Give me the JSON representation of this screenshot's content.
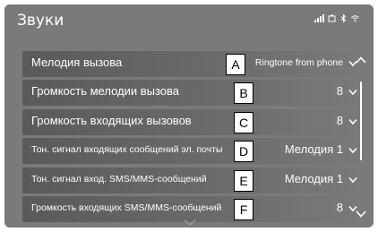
{
  "header": {
    "title": "Звуки"
  },
  "status_icons": [
    "signal-bars-icon",
    "battery-icon",
    "bluetooth-icon",
    "wifi-icon"
  ],
  "rows": [
    {
      "label": "Мелодия вызова",
      "tag": "A",
      "value": "Ringtone from phone"
    },
    {
      "label": "Громкость мелодии вызова",
      "tag": "B",
      "value": "8"
    },
    {
      "label": "Громкость входящих вызовов",
      "tag": "C",
      "value": "8"
    },
    {
      "label": "Тон. сигнал входящих сообщений эл. почты",
      "tag": "D",
      "value": "Мелодия 1"
    },
    {
      "label": "Тон. сигнал вход. SMS/MMS-сообщений",
      "tag": "E",
      "value": "Мелодия 1"
    },
    {
      "label": "Громкость входящих SMS/MMS-сообщений",
      "tag": "F",
      "value": "8"
    }
  ],
  "colors": {
    "background": "#7a7a7a",
    "row": "#5e5e5e",
    "text": "#ffffff"
  }
}
